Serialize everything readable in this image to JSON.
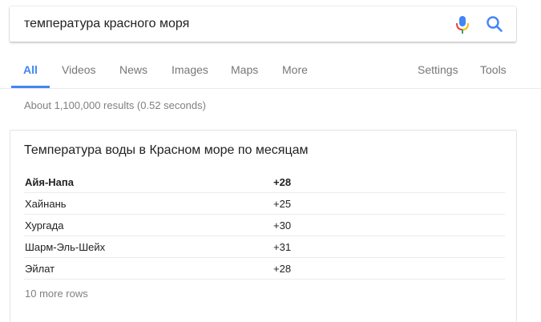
{
  "search": {
    "query": "температура красного моря"
  },
  "icons": {
    "mic": "mic-icon",
    "search": "search-icon",
    "mic_colors": [
      "#4285f4",
      "#ea4335",
      "#fbbc05",
      "#34a853"
    ],
    "search_color": "#4285f4"
  },
  "tabs": {
    "all": "All",
    "videos": "Videos",
    "news": "News",
    "images": "Images",
    "maps": "Maps",
    "more": "More",
    "settings": "Settings",
    "tools": "Tools",
    "active": "All",
    "accent_color": "#4285f4"
  },
  "stats": "About 1,100,000 results (0.52 seconds)",
  "card": {
    "title": "Температура воды в Красном море по месяцам",
    "rows": [
      {
        "city": "Айя-Напа",
        "temp": "+28"
      },
      {
        "city": "Хайнань",
        "temp": "+25"
      },
      {
        "city": "Хургада",
        "temp": "+30"
      },
      {
        "city": "Шарм-Эль-Шейх",
        "temp": "+31"
      },
      {
        "city": "Эйлат",
        "temp": "+28"
      }
    ],
    "more_rows": "10 more rows"
  }
}
